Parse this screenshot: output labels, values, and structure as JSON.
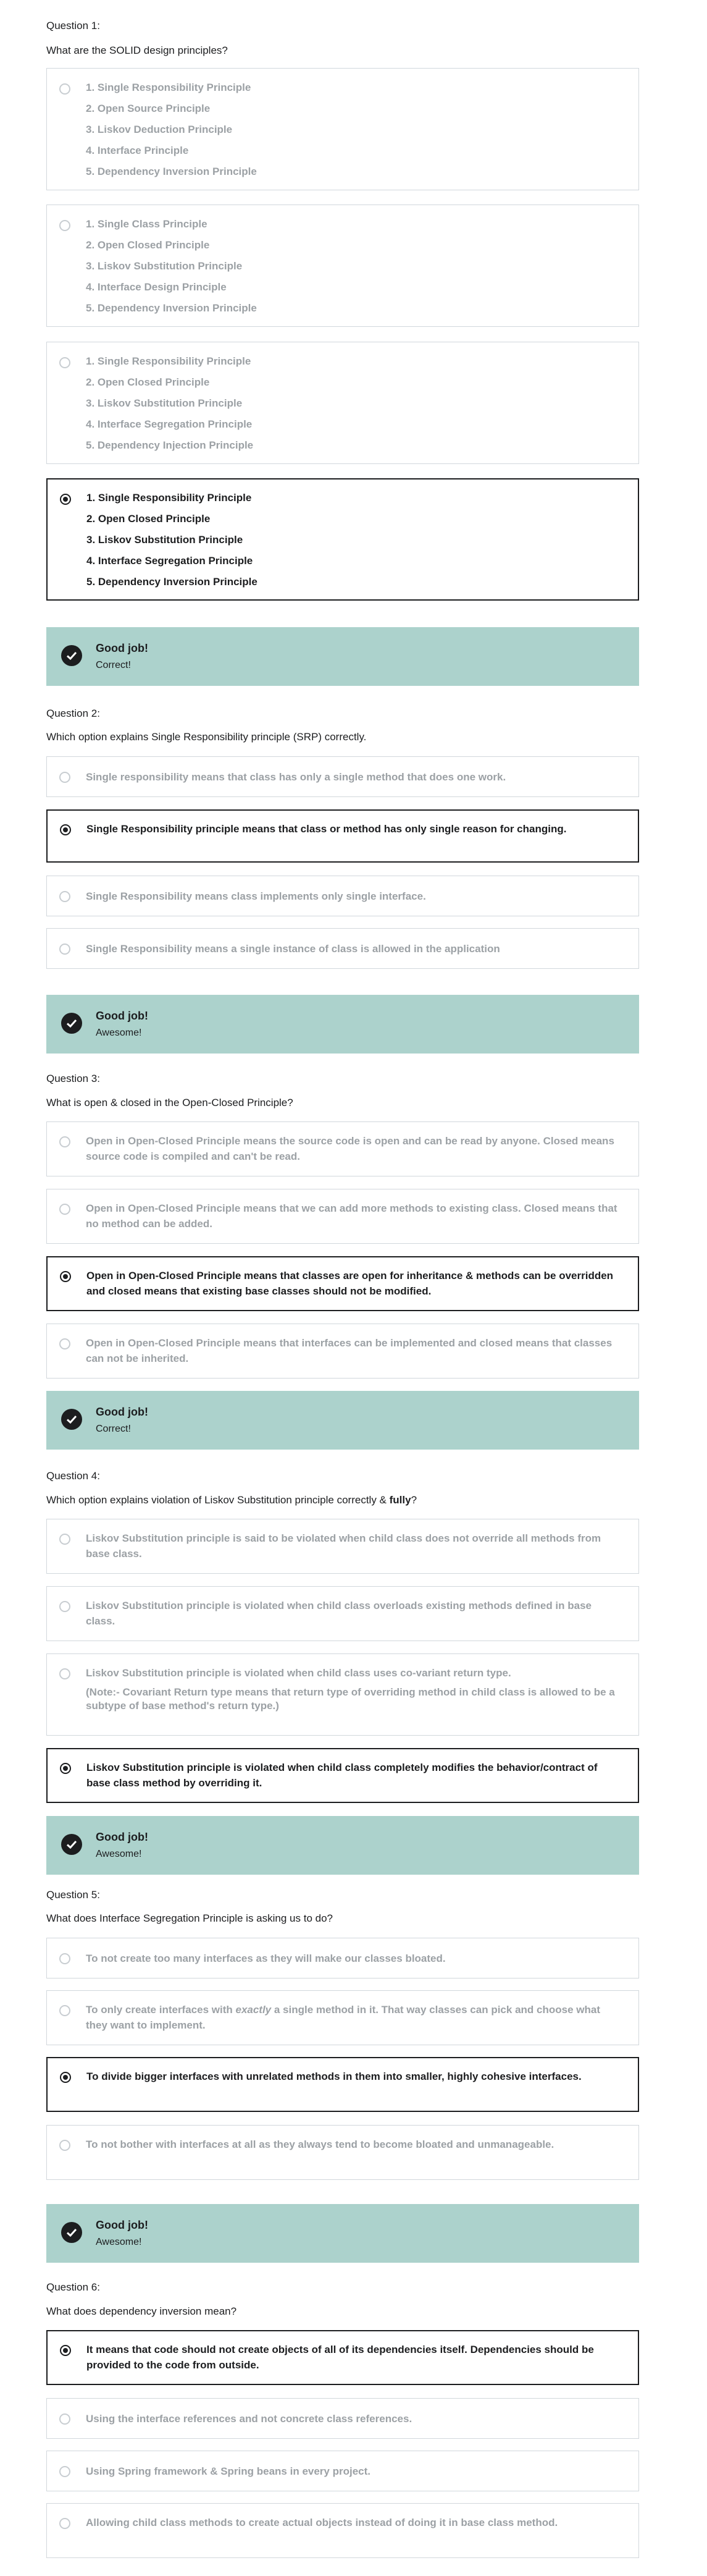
{
  "questions": [
    {
      "number_label": "Question 1:",
      "text": "What are the SOLID design principles?",
      "options": [
        {
          "lines": [
            "1. Single Responsibility Principle",
            "2. Open Source Principle",
            "3. Liskov Deduction Principle",
            "4. Interface Principle",
            "5. Dependency Inversion Principle"
          ],
          "selected": false
        },
        {
          "lines": [
            "1. Single Class Principle",
            "2. Open Closed Principle",
            "3. Liskov Substitution Principle",
            "4. Interface Design Principle",
            "5. Dependency Inversion Principle"
          ],
          "selected": false
        },
        {
          "lines": [
            "1. Single Responsibility Principle",
            "2. Open Closed Principle",
            "3. Liskov Substitution Principle",
            "4. Interface Segregation Principle",
            "5. Dependency Injection Principle"
          ],
          "selected": false
        },
        {
          "lines": [
            "1. Single Responsibility Principle",
            "2. Open Closed Principle",
            "3. Liskov Substitution Principle",
            "4. Interface Segregation Principle",
            "5. Dependency Inversion Principle"
          ],
          "selected": true
        }
      ],
      "feedback": {
        "title": "Good job!",
        "message": "Correct!"
      }
    },
    {
      "number_label": "Question 2:",
      "text": "Which option explains Single Responsibility principle (SRP) correctly.",
      "options": [
        {
          "text": "Single responsibility means that class has only a single method that does one work.",
          "selected": false
        },
        {
          "text": "Single Responsibility principle means that class or method has only single reason for changing.",
          "selected": true
        },
        {
          "text": "Single Responsibility means class implements only single interface.",
          "selected": false
        },
        {
          "text": "Single Responsibility means a single instance of class is allowed in the application",
          "selected": false
        }
      ],
      "feedback": {
        "title": "Good job!",
        "message": "Awesome!"
      }
    },
    {
      "number_label": "Question 3:",
      "text": "What is open & closed in the Open-Closed Principle?",
      "options": [
        {
          "text": "Open in Open-Closed Principle means the source code is open and can be read by anyone. Closed means source code is compiled and can't be read.",
          "selected": false
        },
        {
          "text": "Open in Open-Closed Principle means that we can add more methods to existing class. Closed means that no method can be added.",
          "selected": false
        },
        {
          "text": "Open in Open-Closed Principle means that classes are open for inheritance & methods can be overridden and closed means that existing base classes should not be modified.",
          "selected": true
        },
        {
          "text": "Open in Open-Closed Principle means that interfaces can be implemented and closed means that classes can not be inherited.",
          "selected": false
        }
      ],
      "feedback": {
        "title": "Good job!",
        "message": "Correct!"
      }
    },
    {
      "number_label": "Question 4:",
      "text_before": "Which option explains violation of Liskov Substitution principle correctly & ",
      "text_bold": "fully",
      "text_after": "?",
      "options": [
        {
          "text": "Liskov Substitution principle is said to be violated when child class does not override all methods from base class.",
          "selected": false
        },
        {
          "text": "Liskov Substitution principle is violated when child class overloads existing methods defined in base class.",
          "selected": false
        },
        {
          "text": "Liskov Substitution principle is violated when child class uses co-variant return type.",
          "note": "(Note:- Covariant Return type means that return type of overriding method in child class is allowed to be a subtype of base method's return type.)",
          "selected": false
        },
        {
          "text": "Liskov Substitution principle is violated when child class completely modifies the behavior/contract of base class method by overriding it.",
          "selected": true
        }
      ],
      "feedback": {
        "title": "Good job!",
        "message": "Awesome!"
      }
    },
    {
      "number_label": "Question 5:",
      "text": "What does Interface Segregation Principle is asking us to do?",
      "options": [
        {
          "text": "To not create too many interfaces as they will make our classes bloated.",
          "selected": false
        },
        {
          "text_before": "To only create interfaces with ",
          "text_em": "exactly",
          "text_after": " a single method in it. That way classes can pick and choose what they want to implement.",
          "selected": false
        },
        {
          "text": "To divide bigger interfaces with unrelated methods in them into smaller, highly cohesive interfaces.",
          "selected": true
        },
        {
          "text": "To not bother with interfaces at all as they always tend to become bloated and unmanageable.",
          "selected": false
        }
      ],
      "feedback": {
        "title": "Good job!",
        "message": "Awesome!"
      }
    },
    {
      "number_label": "Question 6:",
      "text": "What does dependency inversion mean?",
      "options": [
        {
          "text": "It means that code should not create objects of all of its dependencies itself. Dependencies should be provided to the code from outside.",
          "selected": true
        },
        {
          "text": "Using the interface references and not concrete class references.",
          "selected": false
        },
        {
          "text": "Using Spring framework & Spring beans in every project.",
          "selected": false
        },
        {
          "text": "Allowing child class methods to create actual objects instead of doing it in base class method.",
          "selected": false
        }
      ]
    }
  ],
  "icons": {
    "radio": "radio-icon",
    "check": "check-circle-icon"
  },
  "colors": {
    "feedback_bg": "#acd2cc",
    "selected_text": "#1c1d1f",
    "unselected_text": "#9ca1a5",
    "border": "#d1d7dc"
  }
}
